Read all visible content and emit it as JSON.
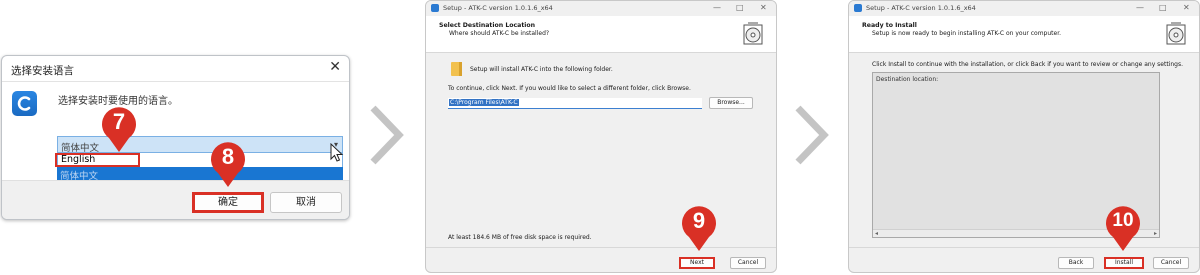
{
  "lang_dialog": {
    "title": "选择安装语言",
    "prompt": "选择安装时要使用的语言。",
    "combo_value": "简体中文",
    "options": [
      "English",
      "简体中文"
    ],
    "ok_label": "确定",
    "cancel_label": "取消",
    "close_glyph": "✕"
  },
  "markers": [
    "7",
    "8",
    "9",
    "10"
  ],
  "marker_color": "#d93025",
  "select_location": {
    "title": "Setup - ATK-C version 1.0.1.6_x64",
    "heading": "Select Destination Location",
    "subheading": "Where should ATK-C be installed?",
    "line1": "Setup will install ATK-C into the following folder.",
    "line2": "To continue, click Next. If you would like to select a different folder, click Browse.",
    "path": "C:\\Program Files\\ATK-C",
    "browse_label": "Browse...",
    "space_note": "At least 184.6 MB of free disk space is required.",
    "next_label": "Next",
    "cancel_label": "Cancel"
  },
  "ready": {
    "title": "Setup - ATK-C version 1.0.1.6_x64",
    "heading": "Ready to Install",
    "subheading": "Setup is now ready to begin installing ATK-C on your computer.",
    "line1": "Click Install to continue with the installation, or click Back if you want to review or change any settings.",
    "memo_label": "Destination location:",
    "back_label": "Back",
    "install_label": "Install",
    "cancel_label": "Cancel"
  },
  "window_controls": [
    "—",
    "□",
    "✕"
  ]
}
